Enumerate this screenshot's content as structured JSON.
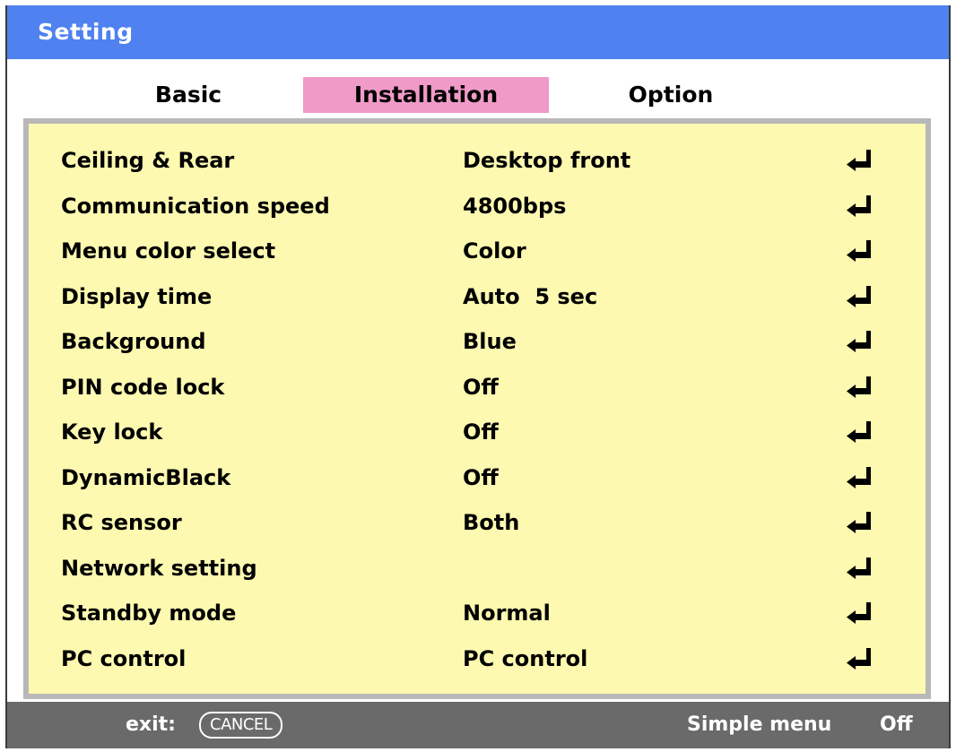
{
  "window": {
    "title": "Setting"
  },
  "tabs": [
    {
      "label": "Basic",
      "active": false
    },
    {
      "label": "Installation",
      "active": true
    },
    {
      "label": "Option",
      "active": false
    }
  ],
  "rows": [
    {
      "label": "Ceiling & Rear",
      "value": "Desktop front"
    },
    {
      "label": "Communication speed",
      "value": "4800bps"
    },
    {
      "label": "Menu color select",
      "value": "Color"
    },
    {
      "label": "Display time",
      "value": "Auto  5 sec"
    },
    {
      "label": "Background",
      "value": "Blue"
    },
    {
      "label": "PIN code lock",
      "value": "Off"
    },
    {
      "label": "Key lock",
      "value": "Off"
    },
    {
      "label": "DynamicBlack",
      "value": "Off"
    },
    {
      "label": "RC sensor",
      "value": "Both"
    },
    {
      "label": "Network setting",
      "value": ""
    },
    {
      "label": "Standby mode",
      "value": "Normal"
    },
    {
      "label": "PC control",
      "value": "PC control"
    }
  ],
  "row_icon": "enter-return-icon",
  "footer": {
    "exit_label": "exit:",
    "cancel_key": "CANCEL",
    "simple_menu_label": "Simple menu",
    "simple_menu_value": "Off"
  },
  "colors": {
    "title_bar": "#4f81f0",
    "active_tab": "#f09ac8",
    "panel_bg": "#fdf9b0",
    "panel_border": "#b8b8b8",
    "footer_bg": "#6a6a6a"
  }
}
